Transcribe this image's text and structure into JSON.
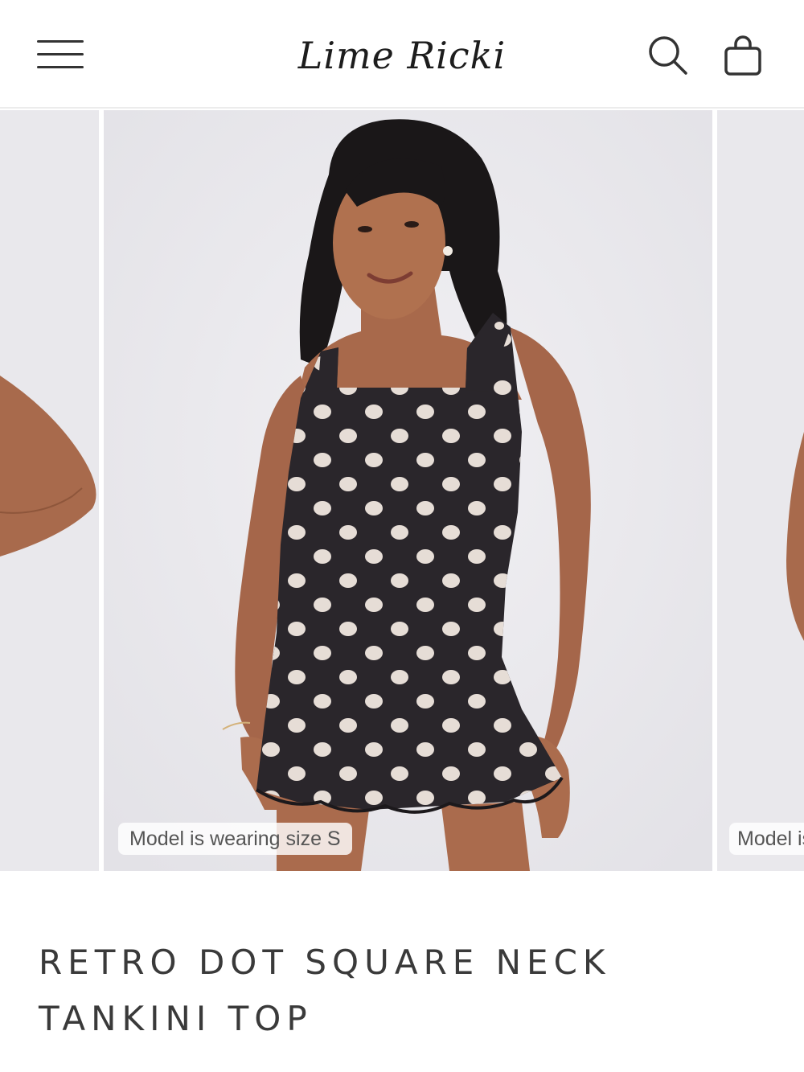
{
  "header": {
    "logo_text": "Lime Ricki",
    "menu_icon": "hamburger-menu-icon",
    "search_icon": "search-icon",
    "cart_icon": "shopping-bag-icon"
  },
  "gallery": {
    "zoom_icon": "zoom-in-icon",
    "main_caption": "Model is wearing size S",
    "next_caption": "Model is wearing size S",
    "colors": {
      "background": "#e9e8ec",
      "garment": "#2a262b",
      "dots": "#e6ddd6"
    }
  },
  "product": {
    "title": "RETRO DOT SQUARE NECK TANKINI TOP"
  }
}
